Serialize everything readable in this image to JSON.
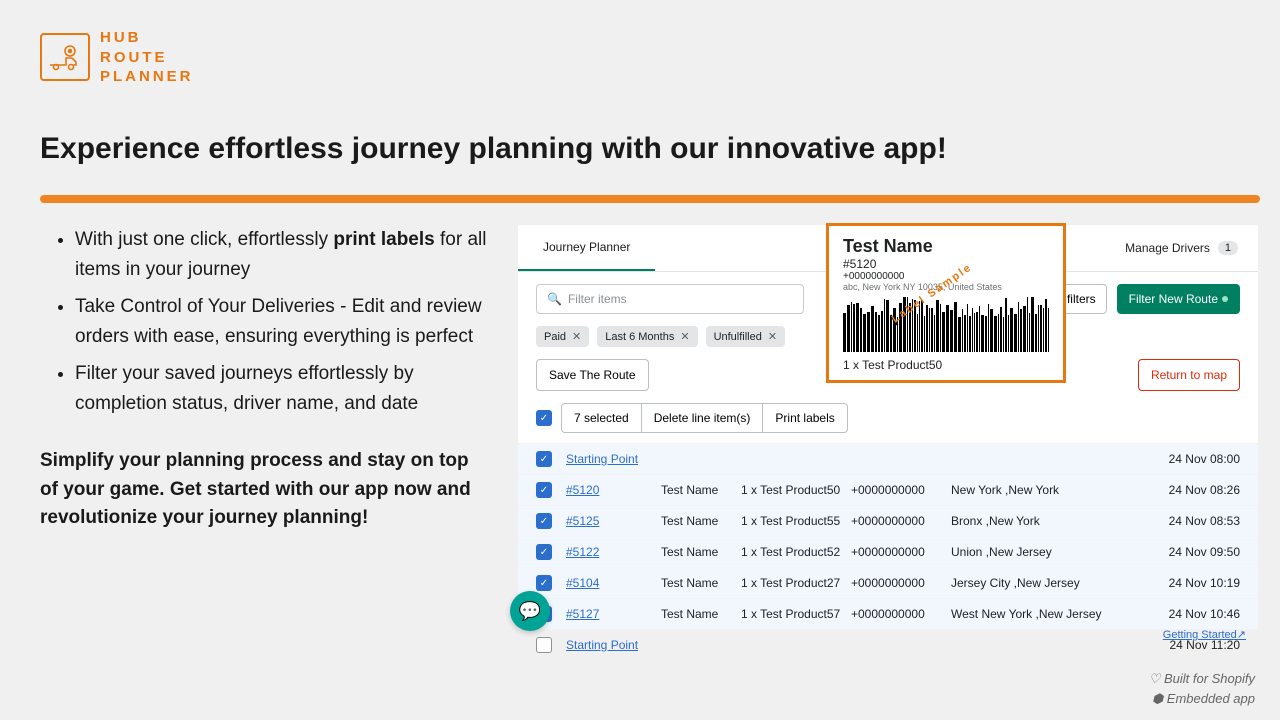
{
  "brand": {
    "line1": "HUB",
    "line2": "ROUTE",
    "line3": "PLANNER"
  },
  "headline": "Experience effortless journey planning with our innovative app!",
  "bullets": [
    {
      "pre": "With just one click, effortlessly ",
      "bold": "print labels",
      "post": " for all items in your journey"
    },
    {
      "pre": "Take Control of Your Deliveries  - Edit and review orders with ease, ensuring everything is perfect",
      "bold": "",
      "post": ""
    },
    {
      "pre": "Filter your saved journeys effortlessly by completion status, driver name, and date",
      "bold": "",
      "post": ""
    }
  ],
  "cta": "Simplify your planning process and stay on top of your game. Get started with our app now and revolutionize your journey planning!",
  "app": {
    "tabs": {
      "active": "Journey Planner",
      "right": "Manage Drivers",
      "driverCount": "1"
    },
    "search": {
      "placeholder": "Filter items"
    },
    "moreFilters": "re filters",
    "filterNew": "Filter New Route",
    "chips": [
      "Paid",
      "Last 6 Months",
      "Unfulfilled"
    ],
    "saveRoute": "Save The Route",
    "returnMap": "Return to map",
    "bulk": {
      "count": "7 selected",
      "delete": "Delete line item(s)",
      "print": "Print labels"
    },
    "rows": [
      {
        "sel": true,
        "id": "Starting Point",
        "name": "",
        "prod": "",
        "phone": "",
        "city": "",
        "time": "24 Nov 08:00",
        "isPoint": true
      },
      {
        "sel": true,
        "id": "#5120",
        "name": "Test Name",
        "prod": "1 x Test Product50",
        "phone": "+0000000000",
        "city": "New York ,New York",
        "time": "24 Nov 08:26"
      },
      {
        "sel": true,
        "id": "#5125",
        "name": "Test Name",
        "prod": "1 x Test Product55",
        "phone": "+0000000000",
        "city": "Bronx ,New York",
        "time": "24 Nov 08:53"
      },
      {
        "sel": true,
        "id": "#5122",
        "name": "Test Name",
        "prod": "1 x Test Product52",
        "phone": "+0000000000",
        "city": "Union ,New Jersey",
        "time": "24 Nov 09:50"
      },
      {
        "sel": true,
        "id": "#5104",
        "name": "Test Name",
        "prod": "1 x Test Product27",
        "phone": "+0000000000",
        "city": "Jersey City ,New Jersey",
        "time": "24 Nov 10:19"
      },
      {
        "sel": true,
        "id": "#5127",
        "name": "Test Name",
        "prod": "1 x Test Product57",
        "phone": "+0000000000",
        "city": "West New York ,New Jersey",
        "time": "24 Nov 10:46"
      },
      {
        "sel": false,
        "id": "Starting Point",
        "name": "",
        "prod": "",
        "phone": "",
        "city": "",
        "time": "24 Nov 11:20",
        "isPoint": true
      }
    ],
    "gettingStarted": "Getting Started↗"
  },
  "label": {
    "name": "Test Name",
    "order": "#5120",
    "phone": "+0000000000",
    "addr": "abc, New York NY 10035, United States",
    "stamp": "Label Sample",
    "prod": "1 x Test Product50"
  },
  "footer": {
    "l1": "♡ Built for Shopify",
    "l2": "⬢ Embedded app"
  }
}
